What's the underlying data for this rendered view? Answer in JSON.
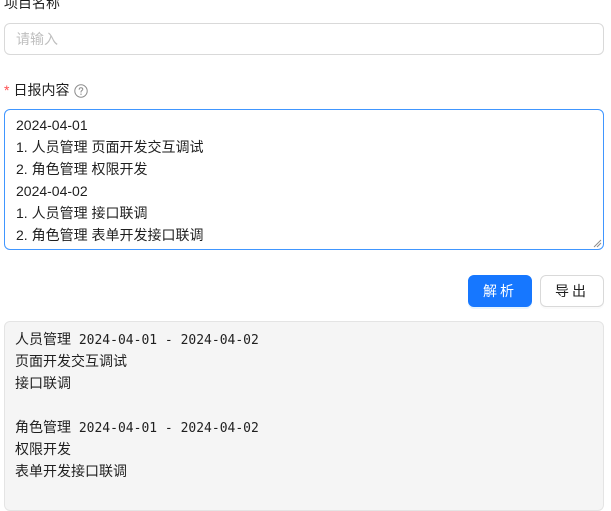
{
  "form": {
    "project_name_label": "项目名称",
    "project_name_placeholder": "请输入",
    "project_name_value": "",
    "daily_report_required_mark": "*",
    "daily_report_label": "日报内容",
    "help_icon": "question-circle-icon",
    "daily_report_lines": [
      "2024-04-01",
      "1. 人员管理 页面开发交互调试",
      "2. 角色管理 权限开发",
      "2024-04-02",
      "1. 人员管理 接口联调",
      "2. 角色管理 表单开发接口联调"
    ]
  },
  "actions": {
    "parse_label": "解析",
    "export_label": "导出"
  },
  "result": {
    "groups": [
      {
        "module": "人员管理",
        "date_range": "2024-04-01 - 2024-04-02",
        "tasks": [
          "页面开发交互调试",
          "接口联调"
        ]
      },
      {
        "module": "角色管理",
        "date_range": "2024-04-01 - 2024-04-02",
        "tasks": [
          "权限开发",
          "表单开发接口联调"
        ]
      }
    ]
  },
  "colors": {
    "primary": "#1677ff",
    "focus_border": "#4096ff",
    "required": "#ff4d4f",
    "result_bg": "#f5f5f5"
  }
}
